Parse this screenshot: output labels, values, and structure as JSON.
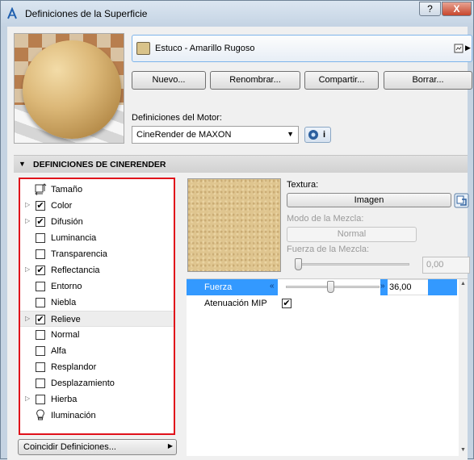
{
  "window": {
    "title": "Definiciones de la Superficie",
    "help_label": "?",
    "close_label": "X"
  },
  "material": {
    "name": "Estuco - Amarillo Rugoso",
    "swatch_color": "#d9c38a"
  },
  "buttons": {
    "new": "Nuevo...",
    "rename": "Renombrar...",
    "share": "Compartir...",
    "delete": "Borrar..."
  },
  "engine": {
    "label": "Definiciones del Motor:",
    "selected": "CineRender de MAXON",
    "info_label": "i"
  },
  "section": {
    "title": "DEFINICIONES DE CINERENDER"
  },
  "channels": [
    {
      "label": "Tamaño",
      "type": "icon",
      "icon": "size-icon",
      "expandable": false,
      "checked": false
    },
    {
      "label": "Color",
      "type": "checkbox",
      "expandable": true,
      "checked": true
    },
    {
      "label": "Difusión",
      "type": "checkbox",
      "expandable": true,
      "checked": true
    },
    {
      "label": "Luminancia",
      "type": "checkbox",
      "expandable": false,
      "checked": false
    },
    {
      "label": "Transparencia",
      "type": "checkbox",
      "expandable": false,
      "checked": false
    },
    {
      "label": "Reflectancia",
      "type": "checkbox",
      "expandable": true,
      "checked": true
    },
    {
      "label": "Entorno",
      "type": "checkbox",
      "expandable": false,
      "checked": false
    },
    {
      "label": "Niebla",
      "type": "checkbox",
      "expandable": false,
      "checked": false
    },
    {
      "label": "Relieve",
      "type": "checkbox",
      "expandable": true,
      "checked": true,
      "selected": true
    },
    {
      "label": "Normal",
      "type": "checkbox",
      "expandable": false,
      "checked": false
    },
    {
      "label": "Alfa",
      "type": "checkbox",
      "expandable": false,
      "checked": false
    },
    {
      "label": "Resplandor",
      "type": "checkbox",
      "expandable": false,
      "checked": false
    },
    {
      "label": "Desplazamiento",
      "type": "checkbox",
      "expandable": false,
      "checked": false
    },
    {
      "label": "Hierba",
      "type": "checkbox",
      "expandable": true,
      "checked": false
    },
    {
      "label": "Iluminación",
      "type": "icon",
      "icon": "lightbulb-icon",
      "expandable": false,
      "checked": false
    }
  ],
  "match_button": "Coincidir Definiciones...",
  "texture": {
    "label": "Textura:",
    "image_button": "Imagen",
    "blend_mode_label": "Modo de la Mezcla:",
    "blend_mode_value": "Normal",
    "blend_strength_label": "Fuerza de la Mezcla:",
    "blend_strength_value": "0,00",
    "blend_strength_fraction": 0.0
  },
  "params": [
    {
      "label": "Fuerza",
      "value": "36,00",
      "slider_fraction": 0.48,
      "selected": true
    },
    {
      "label": "Atenuación MIP",
      "checked": true
    }
  ]
}
